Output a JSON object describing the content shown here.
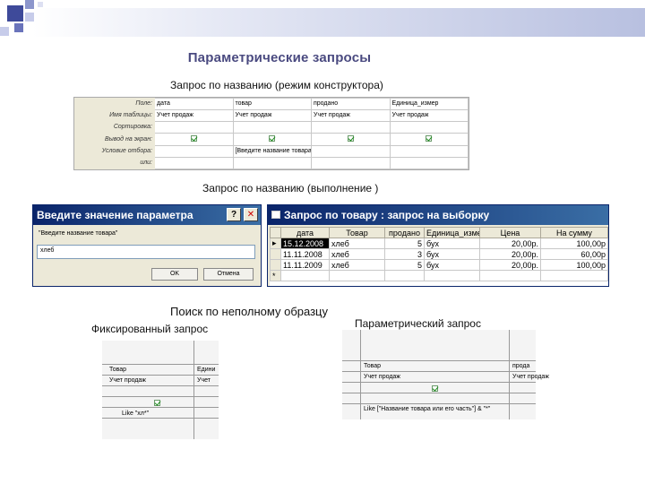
{
  "slide_title": "Параметрические запросы",
  "section1_caption": "Запрос по названию (режим конструктора)",
  "section2_caption": "Запрос по названию (выполнение )",
  "section3_caption": "Поиск по неполному образцу",
  "fixed_caption": "Фиксированный запрос",
  "param_caption": "Параметрический запрос",
  "designer": {
    "row_labels": [
      "Поле:",
      "Имя таблицы:",
      "Сортировка:",
      "Вывод на экран:",
      "Условие отбора:",
      "или:"
    ],
    "columns": [
      {
        "field": "дата",
        "table": "Учет продаж",
        "criteria": ""
      },
      {
        "field": "товар",
        "table": "Учет продаж",
        "criteria": "[Введите название товара]"
      },
      {
        "field": "продано",
        "table": "Учет продаж",
        "criteria": ""
      },
      {
        "field": "Единица_измер",
        "table": "Учет продаж",
        "criteria": ""
      }
    ]
  },
  "param_dialog": {
    "title": "Введите значение параметра",
    "prompt": "Введите название товара",
    "value": "хлеб",
    "ok_label": "OK",
    "cancel_label": "Отмена",
    "help_glyph": "?",
    "close_glyph": "✕"
  },
  "results_window": {
    "title": "Запрос по товару : запрос на выборку",
    "headers": [
      "дата",
      "Товар",
      "продано",
      "Единица_измер",
      "Цена",
      "На сумму"
    ],
    "rows": [
      {
        "date": "15.12.2008",
        "item": "хлеб",
        "sold": "5",
        "unit": "бух",
        "price": "20,00р.",
        "sum": "100,00р"
      },
      {
        "date": "11.11.2008",
        "item": "хлеб",
        "sold": "3",
        "unit": "бух",
        "price": "20,00р.",
        "sum": "60,00р"
      },
      {
        "date": "11.11.2009",
        "item": "хлеб",
        "sold": "5",
        "unit": "бух",
        "price": "20,00р.",
        "sum": "100,00р"
      }
    ]
  },
  "fixed_grid": {
    "col1": "Товар",
    "col1_table": "Учет продаж",
    "col2": "Едини",
    "col2_table": "Учет",
    "criteria": "Like \"хл*\""
  },
  "param_grid": {
    "col1": "Товар",
    "col1_table": "Учет продаж",
    "col2": "прода",
    "col2_table": "Учет продаж",
    "criteria": "Like [\"Название товара или его часть\"] & \"*\""
  },
  "colors": {
    "title_bar": "#0a246a",
    "title_text": "#4a4a80",
    "check": "#1a8a1a"
  }
}
